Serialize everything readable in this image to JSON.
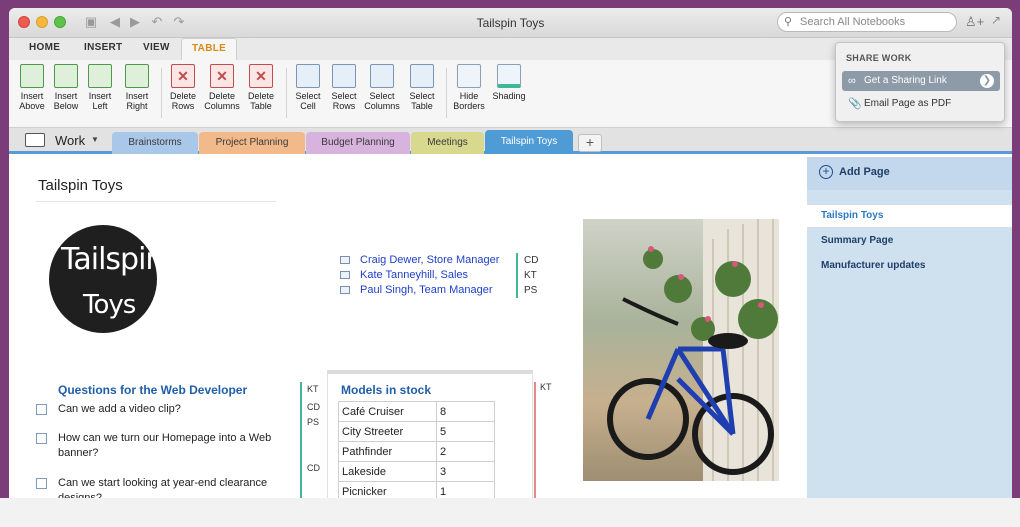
{
  "window": {
    "title": "Tailspin Toys"
  },
  "search": {
    "placeholder": "Search All Notebooks"
  },
  "ribbon_tabs": [
    {
      "label": "HOME"
    },
    {
      "label": "INSERT"
    },
    {
      "label": "VIEW"
    },
    {
      "label": "TABLE",
      "active": true
    }
  ],
  "ribbon_buttons": [
    {
      "l1": "Insert",
      "l2": "Above"
    },
    {
      "l1": "Insert",
      "l2": "Below"
    },
    {
      "l1": "Insert",
      "l2": "Left"
    },
    {
      "l1": "Insert",
      "l2": "Right"
    },
    {
      "l1": "Delete",
      "l2": "Rows"
    },
    {
      "l1": "Delete",
      "l2": "Columns"
    },
    {
      "l1": "Delete",
      "l2": "Table"
    },
    {
      "l1": "Select",
      "l2": "Cell"
    },
    {
      "l1": "Select",
      "l2": "Rows"
    },
    {
      "l1": "Select",
      "l2": "Columns"
    },
    {
      "l1": "Select",
      "l2": "Table"
    },
    {
      "l1": "Hide",
      "l2": "Borders"
    },
    {
      "l1": "Shading",
      "l2": ""
    }
  ],
  "share_menu": {
    "header": "SHARE WORK",
    "options": [
      {
        "label": "Get a Sharing Link",
        "icon": "link-icon"
      },
      {
        "label": "Email Page as PDF",
        "icon": "paperclip-icon"
      }
    ]
  },
  "notebook": {
    "name": "Work"
  },
  "sections": [
    {
      "label": "Brainstorms",
      "color": "#a9c7e8"
    },
    {
      "label": "Project Planning",
      "color": "#f2b98a"
    },
    {
      "label": "Budget Planning",
      "color": "#d7b3de"
    },
    {
      "label": "Meetings",
      "color": "#d8d88f"
    },
    {
      "label": "Tailspin Toys",
      "color": "#4e9bd6",
      "active": true
    }
  ],
  "page": {
    "title": "Tailspin Toys",
    "logo_line1": "Tailspin",
    "logo_line2": "Toys",
    "contacts": [
      {
        "name": "Craig Dewer, Store Manager",
        "tag": "CD"
      },
      {
        "name": "Kate Tanneyhill, Sales",
        "tag": "KT"
      },
      {
        "name": "Paul Singh, Team Manager",
        "tag": "PS"
      }
    ],
    "questions_heading": "Questions for the Web Developer",
    "questions": [
      {
        "text": "Can we add a video clip?"
      },
      {
        "text": "How can we turn our Homepage into a Web banner?"
      },
      {
        "text": "Can we start looking at year-end clearance designs?"
      }
    ],
    "question_tags": [
      "KT",
      "CD",
      "PS",
      "CD"
    ],
    "models_heading": "Models in stock",
    "models_tag": "KT",
    "models": [
      {
        "name": "Café Cruiser",
        "qty": "8"
      },
      {
        "name": "City Streeter",
        "qty": "5"
      },
      {
        "name": "Pathfinder",
        "qty": "2"
      },
      {
        "name": "Lakeside",
        "qty": "3"
      },
      {
        "name": "Picnicker",
        "qty": "1"
      }
    ]
  },
  "pages_pane": {
    "add_label": "Add Page",
    "items": [
      {
        "label": "Tailspin Toys",
        "selected": true
      },
      {
        "label": "Summary Page"
      },
      {
        "label": "Manufacturer updates"
      }
    ]
  }
}
